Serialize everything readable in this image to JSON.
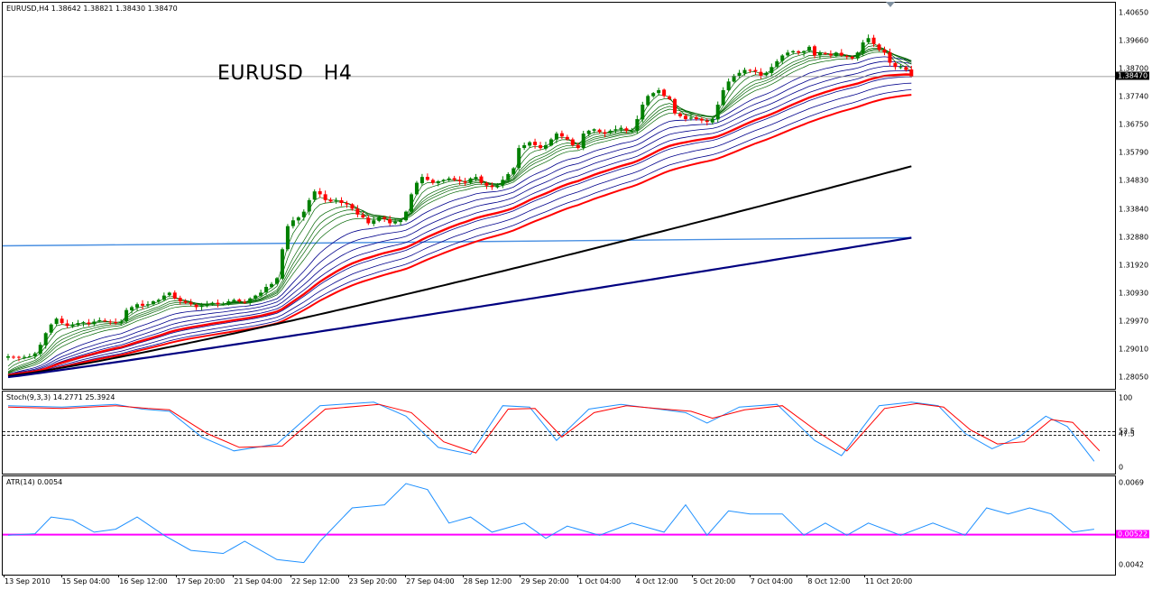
{
  "chart_header": {
    "symbol_line": "EURUSD,H4  1.38642 1.38821 1.38430 1.38470",
    "big_label": "EURUSD   H4"
  },
  "indicators": {
    "stoch_label": "Stoch(9,3,3) 14.2771 25.3924",
    "atr_label": "ATR(14) 0.0054"
  },
  "price_axis": {
    "ticks": [
      "1.40650",
      "1.39660",
      "1.38700",
      "1.37740",
      "1.36750",
      "1.35790",
      "1.34830",
      "1.33840",
      "1.32880",
      "1.31920",
      "1.30930",
      "1.29970",
      "1.29010",
      "1.28050"
    ],
    "current_price": "1.38470"
  },
  "stoch_axis": {
    "ticks": [
      "100",
      "52.5",
      "47.5",
      "0"
    ]
  },
  "atr_axis": {
    "ticks": [
      "0.0069",
      "0.0042"
    ],
    "current": "0.00522"
  },
  "time_axis": {
    "labels": [
      "13 Sep 2010",
      "15 Sep 04:00",
      "16 Sep 12:00",
      "17 Sep 20:00",
      "21 Sep 04:00",
      "22 Sep 12:00",
      "23 Sep 20:00",
      "27 Sep 04:00",
      "28 Sep 12:00",
      "29 Sep 20:00",
      "1 Oct 04:00",
      "4 Oct 12:00",
      "5 Oct 20:00",
      "7 Oct 04:00",
      "8 Oct 12:00",
      "11 Oct 20:00"
    ]
  },
  "colors": {
    "bull": "#008000",
    "bear": "#ff0000",
    "short_ma": "#006400",
    "mid_ma": "#00008b",
    "red_ma": "#ff0000",
    "black_ma": "#000000",
    "navy_ma": "#000080",
    "hline": "#4a90e2",
    "stoch_main": "#1e90ff",
    "stoch_signal": "#ff0000",
    "atr": "#1e90ff",
    "atr_level": "#ff00ff"
  },
  "chart_data": [
    {
      "type": "candlestick",
      "title": "EURUSD,H4",
      "ylim": [
        1.2805,
        1.4065
      ],
      "closes": [
        1.288,
        1.2878,
        1.2875,
        1.2878,
        1.288,
        1.289,
        1.292,
        1.296,
        1.299,
        1.301,
        1.2995,
        1.2985,
        1.299,
        1.2995,
        1.2998,
        1.2992,
        1.3,
        1.3005,
        1.3002,
        1.2998,
        1.2995,
        1.3,
        1.304,
        1.305,
        1.306,
        1.3055,
        1.306,
        1.307,
        1.3075,
        1.309,
        1.31,
        1.308,
        1.307,
        1.3065,
        1.306,
        1.305,
        1.3055,
        1.306,
        1.3065,
        1.306,
        1.306,
        1.307,
        1.3075,
        1.307,
        1.3065,
        1.308,
        1.309,
        1.31,
        1.312,
        1.313,
        1.315,
        1.325,
        1.333,
        1.335,
        1.336,
        1.338,
        1.342,
        1.345,
        1.344,
        1.342,
        1.3415,
        1.342,
        1.341,
        1.3405,
        1.339,
        1.337,
        1.336,
        1.334,
        1.335,
        1.336,
        1.3355,
        1.334,
        1.3345,
        1.335,
        1.338,
        1.344,
        1.348,
        1.35,
        1.349,
        1.348,
        1.3485,
        1.349,
        1.3495,
        1.349,
        1.3485,
        1.348,
        1.3495,
        1.35,
        1.348,
        1.347,
        1.3465,
        1.347,
        1.349,
        1.351,
        1.353,
        1.36,
        1.361,
        1.362,
        1.361,
        1.36,
        1.361,
        1.363,
        1.365,
        1.364,
        1.363,
        1.361,
        1.36,
        1.365,
        1.366,
        1.3665,
        1.3655,
        1.365,
        1.366,
        1.3665,
        1.367,
        1.366,
        1.366,
        1.37,
        1.375,
        1.378,
        1.379,
        1.38,
        1.378,
        1.377,
        1.372,
        1.371,
        1.37,
        1.3705,
        1.37,
        1.3695,
        1.369,
        1.37,
        1.375,
        1.38,
        1.383,
        1.385,
        1.386,
        1.387,
        1.387,
        1.3865,
        1.385,
        1.386,
        1.388,
        1.39,
        1.392,
        1.393,
        1.3935,
        1.393,
        1.3935,
        1.395,
        1.392,
        1.393,
        1.3925,
        1.392,
        1.393,
        1.392,
        1.3915,
        1.391,
        1.393,
        1.3965,
        1.398,
        1.396,
        1.394,
        1.393,
        1.3895,
        1.388,
        1.388,
        1.387,
        1.3847
      ]
    },
    {
      "type": "line",
      "title": "Stoch(9,3,3)",
      "ylim": [
        0,
        100
      ],
      "levels": [
        52.5,
        47.5
      ],
      "main_knots": [
        [
          0,
          90
        ],
        [
          10,
          88
        ],
        [
          20,
          92
        ],
        [
          25,
          85
        ],
        [
          30,
          82
        ],
        [
          36,
          45
        ],
        [
          42,
          25
        ],
        [
          50,
          35
        ],
        [
          58,
          90
        ],
        [
          68,
          95
        ],
        [
          74,
          75
        ],
        [
          80,
          30
        ],
        [
          86,
          20
        ],
        [
          92,
          90
        ],
        [
          97,
          88
        ],
        [
          102,
          40
        ],
        [
          108,
          85
        ],
        [
          114,
          92
        ],
        [
          121,
          85
        ],
        [
          126,
          80
        ],
        [
          130,
          65
        ],
        [
          136,
          88
        ],
        [
          143,
          92
        ],
        [
          150,
          40
        ],
        [
          155,
          18
        ],
        [
          162,
          90
        ],
        [
          168,
          95
        ],
        [
          173,
          90
        ],
        [
          178,
          50
        ],
        [
          183,
          28
        ],
        [
          188,
          45
        ],
        [
          193,
          75
        ],
        [
          197,
          60
        ],
        [
          202,
          10
        ]
      ],
      "signal_knots": [
        [
          0,
          88
        ],
        [
          10,
          86
        ],
        [
          20,
          90
        ],
        [
          26,
          86
        ],
        [
          30,
          84
        ],
        [
          37,
          50
        ],
        [
          43,
          30
        ],
        [
          51,
          32
        ],
        [
          59,
          85
        ],
        [
          69,
          92
        ],
        [
          75,
          80
        ],
        [
          81,
          38
        ],
        [
          87,
          22
        ],
        [
          93,
          85
        ],
        [
          98,
          86
        ],
        [
          103,
          45
        ],
        [
          109,
          80
        ],
        [
          115,
          90
        ],
        [
          122,
          85
        ],
        [
          127,
          82
        ],
        [
          131,
          72
        ],
        [
          137,
          84
        ],
        [
          144,
          90
        ],
        [
          151,
          50
        ],
        [
          156,
          25
        ],
        [
          163,
          86
        ],
        [
          169,
          93
        ],
        [
          174,
          88
        ],
        [
          179,
          55
        ],
        [
          184,
          35
        ],
        [
          189,
          38
        ],
        [
          194,
          70
        ],
        [
          198,
          66
        ],
        [
          203,
          25
        ]
      ]
    },
    {
      "type": "line",
      "title": "ATR(14)",
      "ylim": [
        0.0042,
        0.0069
      ],
      "level": 0.00522,
      "knots": [
        [
          0,
          0.0052
        ],
        [
          5,
          0.00525
        ],
        [
          8,
          0.0058
        ],
        [
          12,
          0.0057
        ],
        [
          16,
          0.0053
        ],
        [
          20,
          0.0054
        ],
        [
          24,
          0.0058
        ],
        [
          29,
          0.0052
        ],
        [
          34,
          0.0047
        ],
        [
          40,
          0.0046
        ],
        [
          44,
          0.005
        ],
        [
          50,
          0.0044
        ],
        [
          55,
          0.0043
        ],
        [
          58,
          0.005
        ],
        [
          64,
          0.0061
        ],
        [
          70,
          0.0062
        ],
        [
          74,
          0.0069
        ],
        [
          78,
          0.0067
        ],
        [
          82,
          0.0056
        ],
        [
          86,
          0.0058
        ],
        [
          90,
          0.0053
        ],
        [
          96,
          0.0056
        ],
        [
          100,
          0.0051
        ],
        [
          104,
          0.0055
        ],
        [
          110,
          0.0052
        ],
        [
          116,
          0.0056
        ],
        [
          122,
          0.0053
        ],
        [
          126,
          0.0062
        ],
        [
          130,
          0.0052
        ],
        [
          134,
          0.006
        ],
        [
          138,
          0.0059
        ],
        [
          144,
          0.0059
        ],
        [
          148,
          0.0052
        ],
        [
          152,
          0.0056
        ],
        [
          156,
          0.0052
        ],
        [
          160,
          0.0056
        ],
        [
          166,
          0.0052
        ],
        [
          172,
          0.0056
        ],
        [
          178,
          0.0052
        ],
        [
          182,
          0.0061
        ],
        [
          186,
          0.0059
        ],
        [
          190,
          0.0061
        ],
        [
          194,
          0.0059
        ],
        [
          198,
          0.0053
        ],
        [
          202,
          0.0054
        ]
      ]
    }
  ]
}
